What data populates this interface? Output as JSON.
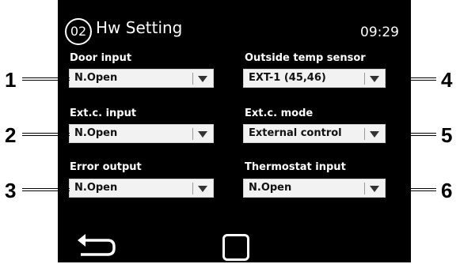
{
  "header": {
    "page_number": "02",
    "title": "Hw Setting",
    "time": "09:29"
  },
  "fields": {
    "door_input": {
      "label": "Door input",
      "value": "N.Open"
    },
    "ext_c_input": {
      "label": "Ext.c. input",
      "value": "N.Open"
    },
    "error_output": {
      "label": "Error output",
      "value": "N.Open"
    },
    "outside_temp_sensor": {
      "label": "Outside temp sensor",
      "value": "EXT-1 (45,46)"
    },
    "ext_c_mode": {
      "label": "Ext.c. mode",
      "value": "External control"
    },
    "thermostat_input": {
      "label": "Thermostat input",
      "value": "N.Open"
    }
  },
  "callouts": {
    "c1": "1",
    "c2": "2",
    "c3": "3",
    "c4": "4",
    "c5": "5",
    "c6": "6"
  },
  "icons": {
    "back": "back-arrow-icon",
    "home": "home-square-icon",
    "dropdown": "chevron-down-icon"
  },
  "colors": {
    "screen_bg": "#000000",
    "text": "#ffffff",
    "field_bg": "#f2f2f2"
  }
}
